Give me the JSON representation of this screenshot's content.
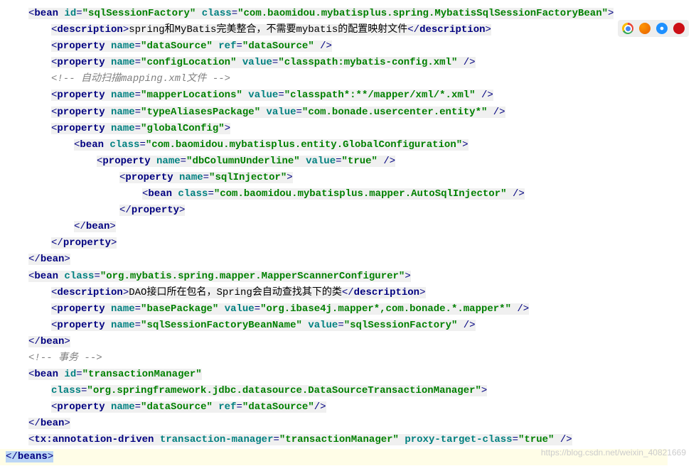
{
  "b1": {
    "id": "sqlSessionFactory",
    "class": "com.baomidou.mybatisplus.spring.MybatisSqlSessionFactoryBean"
  },
  "desc1": "spring和MyBatis完美整合，不需要mybatis的配置映射文件",
  "p1": {
    "name": "dataSource",
    "ref": "dataSource"
  },
  "p2": {
    "name": "configLocation",
    "value": "classpath:mybatis-config.xml"
  },
  "cmt1": "自动扫描mapping.xml文件",
  "p3": {
    "name": "mapperLocations",
    "value": "classpath*:**/mapper/xml/*.xml"
  },
  "p4": {
    "name": "typeAliasesPackage",
    "value": "com.bonade.usercenter.entity*"
  },
  "p5": {
    "name": "globalConfig"
  },
  "gc": {
    "class": "com.baomidou.mybatisplus.entity.GlobalConfiguration"
  },
  "p6": {
    "name": "dbColumnUnderline",
    "value": "true"
  },
  "p7": {
    "name": "sqlInjector"
  },
  "inj": {
    "class": "com.baomidou.mybatisplus.mapper.AutoSqlInjector"
  },
  "b2": {
    "class": "org.mybatis.spring.mapper.MapperScannerConfigurer"
  },
  "desc2": "DAO接口所在包名，Spring会自动查找其下的类",
  "p8": {
    "name": "basePackage",
    "value": "org.ibase4j.mapper*,com.bonade.*.mapper*"
  },
  "p9": {
    "name": "sqlSessionFactoryBeanName",
    "value": "sqlSessionFactory"
  },
  "cmt2": "事务",
  "b3": {
    "id": "transactionManager",
    "class": "org.springframework.jdbc.datasource.DataSourceTransactionManager"
  },
  "p10": {
    "name": "dataSource",
    "ref": "dataSource"
  },
  "tx": {
    "manager": "transactionManager",
    "proxy": "true"
  },
  "watermark": "https://blog.csdn.net/weixin_40821669"
}
